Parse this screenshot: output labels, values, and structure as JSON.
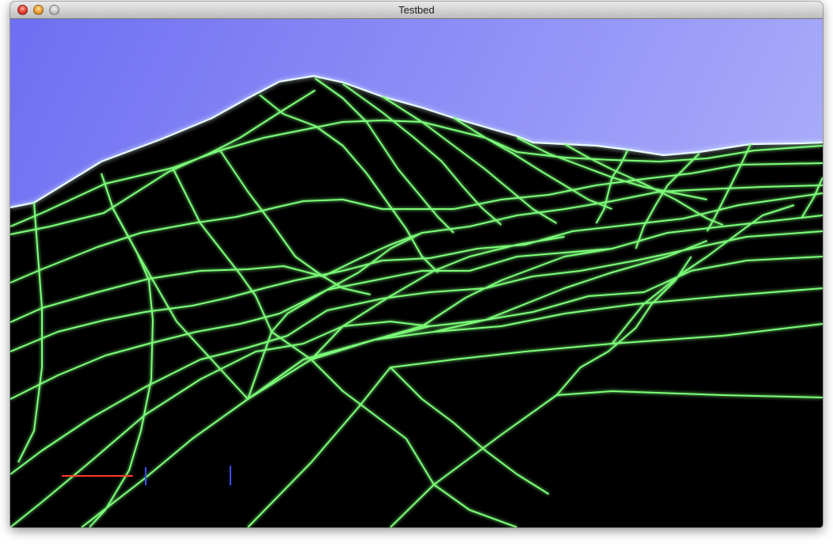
{
  "window": {
    "title": "Testbed"
  },
  "titlebar_buttons": [
    {
      "name": "close-button",
      "icon": "close-icon"
    },
    {
      "name": "minimize-button",
      "icon": "minimize-icon"
    },
    {
      "name": "zoom-button",
      "icon": "zoom-icon"
    }
  ],
  "scene": {
    "sky_color_top": "#6e6ff2",
    "sky_color_bottom": "#a9abfa",
    "terrain_color": "#000000",
    "grid_line_color": "#7dff7a",
    "horizon_glow_color": "#e8fbff",
    "axis_x_color": "#ff3a2a",
    "axis_marker_color": "#3b4dff"
  }
}
